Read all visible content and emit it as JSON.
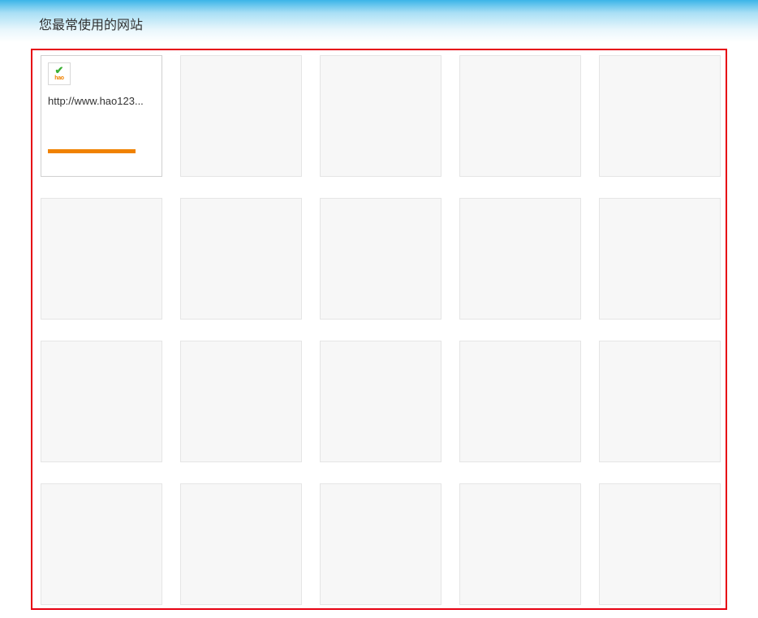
{
  "header": {
    "title": "您最常使用的网站"
  },
  "tiles": [
    {
      "type": "filled",
      "favicon": "hao123",
      "url": "http://www.hao123..."
    },
    {
      "type": "empty"
    },
    {
      "type": "empty"
    },
    {
      "type": "empty"
    },
    {
      "type": "empty"
    },
    {
      "type": "empty"
    },
    {
      "type": "empty"
    },
    {
      "type": "empty"
    },
    {
      "type": "empty"
    },
    {
      "type": "empty"
    },
    {
      "type": "empty"
    },
    {
      "type": "empty"
    },
    {
      "type": "empty"
    },
    {
      "type": "empty"
    },
    {
      "type": "empty"
    },
    {
      "type": "empty"
    },
    {
      "type": "empty"
    },
    {
      "type": "empty"
    },
    {
      "type": "empty"
    },
    {
      "type": "empty"
    }
  ]
}
